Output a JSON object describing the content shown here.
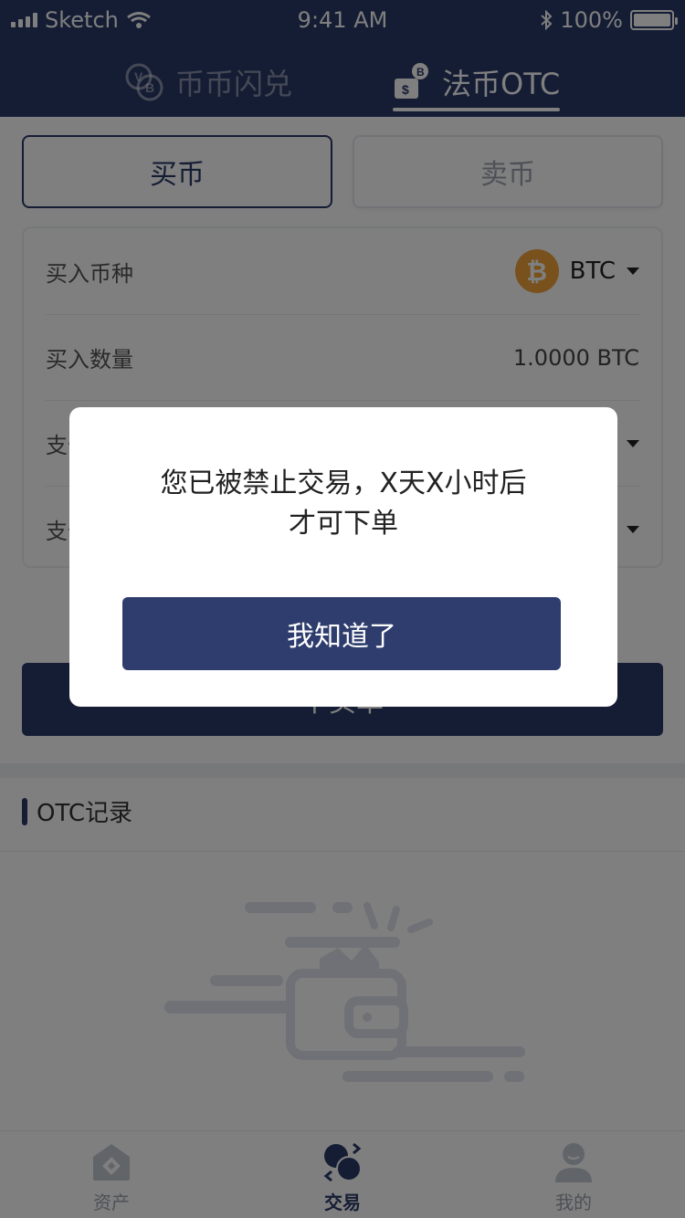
{
  "status_bar": {
    "carrier": "Sketch",
    "time": "9:41 AM",
    "battery": "100%"
  },
  "header": {
    "tabs": [
      {
        "label": "币币闪兑",
        "icon": "coin-swap-icon",
        "active": false
      },
      {
        "label": "法币OTC",
        "icon": "fiat-otc-icon",
        "active": true
      }
    ]
  },
  "trade_toggle": {
    "buy_label": "买币",
    "sell_label": "卖币"
  },
  "form": {
    "rows": [
      {
        "label": "买入币种",
        "value": "BTC"
      },
      {
        "label": "买入数量",
        "value": "1.0000  BTC"
      },
      {
        "label": "支付方式",
        "value": ""
      },
      {
        "label": "支付方式",
        "value": ""
      }
    ]
  },
  "submit": {
    "label": "下买单"
  },
  "records": {
    "title": "OTC记录"
  },
  "bottom_nav": {
    "items": [
      {
        "label": "资产",
        "icon": "assets-icon"
      },
      {
        "label": "交易",
        "icon": "trade-icon",
        "active": true
      },
      {
        "label": "我的",
        "icon": "profile-icon"
      }
    ]
  },
  "dialog": {
    "message_line1": "您已被禁止交易，X天X小时后",
    "message_line2": "才可下单",
    "button_label": "我知道了"
  },
  "colors": {
    "primary": "#2b3a68",
    "bitcoin": "#f1a33a",
    "overlay": "rgba(0,0,0,0.5)"
  }
}
